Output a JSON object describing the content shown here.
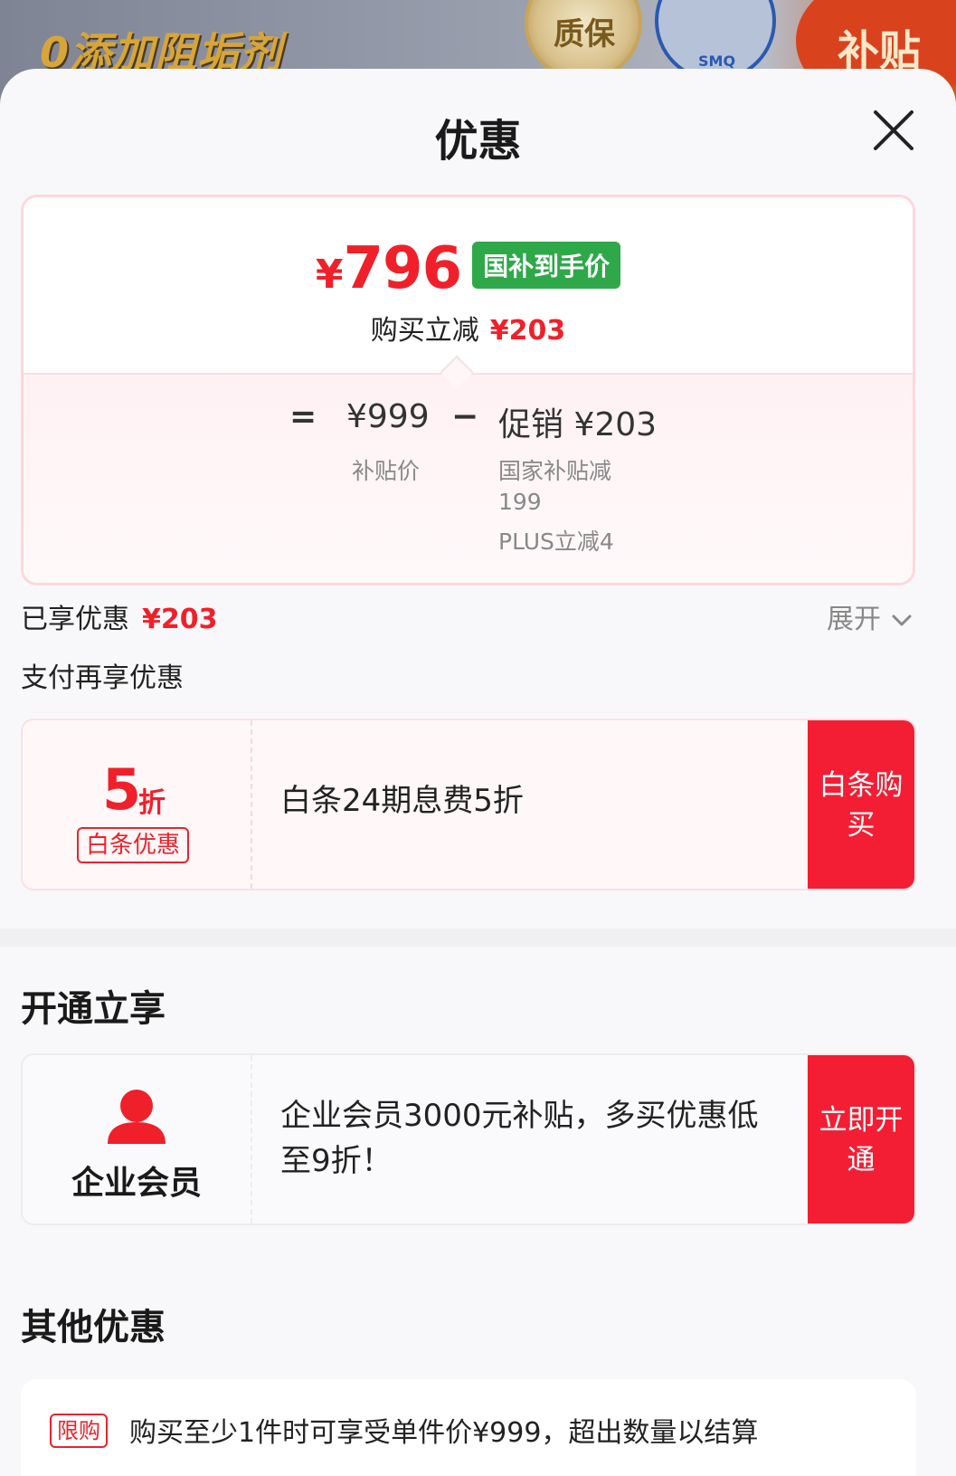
{
  "banner": {
    "slogan": "0添加阻垢剂",
    "badge_quality": "质保",
    "badge_smq": "SMQ",
    "badge_subsidy": "补贴"
  },
  "sheet": {
    "title": "优惠",
    "close_icon": "close-icon"
  },
  "price_card": {
    "currency": "¥",
    "final_price": "796",
    "tag": "国补到手价",
    "reduce_label": "购买立减",
    "reduce_amount": "¥203",
    "formula": {
      "eq": "=",
      "base": "¥999",
      "minus": "−",
      "promo": "促销 ¥203"
    },
    "base_label": "补贴价",
    "gov_label": "国家补贴减199",
    "plus_label": "PLUS立减4"
  },
  "enjoyed": {
    "label": "已享优惠",
    "amount": "¥203",
    "expand_label": "展开"
  },
  "pay_more": {
    "label": "支付再享优惠"
  },
  "baitiao": {
    "discount_num": "5",
    "discount_unit": "折",
    "tag": "白条优惠",
    "description": "白条24期息费5折",
    "action": "白条购买"
  },
  "open_section": {
    "title": "开通立享",
    "member_label": "企业会员",
    "description": "企业会员3000元补贴，多买优惠低至9折！",
    "action": "立即开通"
  },
  "other_section": {
    "title": "其他优惠",
    "limit_tag": "限购",
    "text": "购买至少1件时可享受单件价¥999，超出数量以结算"
  },
  "colors": {
    "accent_red": "#f0202a",
    "action_red": "#f31e33",
    "gov_green": "#2fa84a"
  }
}
